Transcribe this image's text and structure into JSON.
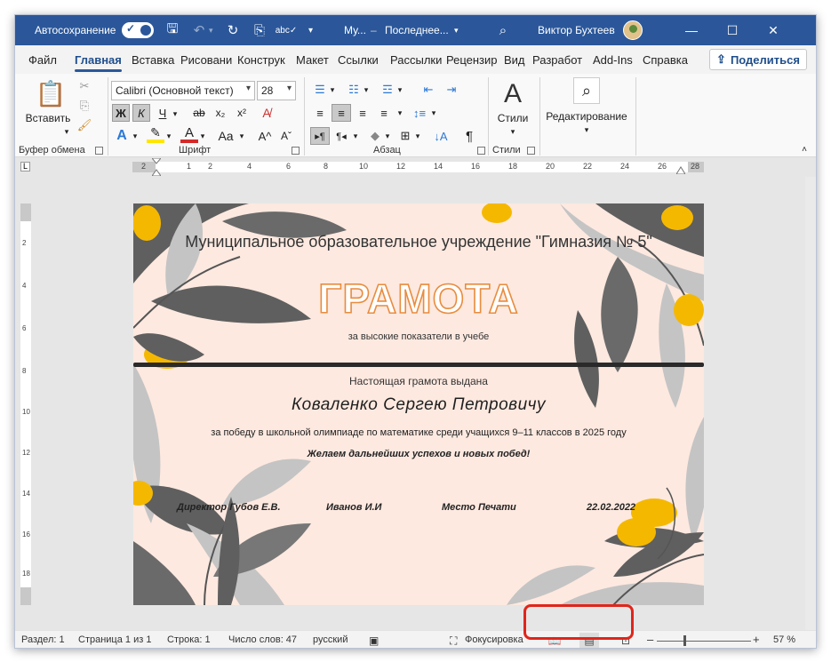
{
  "titlebar": {
    "autosave_label": "Автосохранение",
    "doc_title": "Му...",
    "save_location": "Последнее...",
    "user_name": "Виктор Бухтеев"
  },
  "tabs": [
    "Файл",
    "Главная",
    "Вставка",
    "Рисовани",
    "Конструк",
    "Макет",
    "Ссылки",
    "Рассылки",
    "Рецензир",
    "Вид",
    "Разработ",
    "Add-Ins",
    "Справка"
  ],
  "share_label": "Поделиться",
  "ribbon": {
    "clipboard": {
      "paste_label": "Вставить",
      "group_label": "Буфер обмена"
    },
    "font": {
      "font_name": "Calibri (Основной текст)",
      "font_size": "28",
      "bold": "Ж",
      "italic": "К",
      "underline": "Ч",
      "strikethrough": "ab",
      "subscript": "x₂",
      "superscript": "x²",
      "case_label": "Aa",
      "grow_label": "A^",
      "shrink_label": "Aˇ",
      "group_label": "Шрифт"
    },
    "paragraph": {
      "group_label": "Абзац"
    },
    "styles": {
      "label": "Стили",
      "group_label": "Стили"
    },
    "editing": {
      "label": "Редактирование"
    }
  },
  "ruler": [
    "2",
    "1",
    "2",
    "4",
    "6",
    "8",
    "10",
    "12",
    "14",
    "16",
    "18",
    "20",
    "22",
    "24",
    "26",
    "28"
  ],
  "vruler": [
    "2",
    "4",
    "6",
    "8",
    "10",
    "12",
    "14",
    "16",
    "18"
  ],
  "document": {
    "institution": "Муниципальное образовательное учреждение \"Гимназия № 5\"",
    "title": "ГРАМОТА",
    "subtitle": "за высокие показатели в учебе",
    "issued": "Настоящая грамота выдана",
    "recipient": "Коваленко Сергею Петровичу",
    "reason": "за победу в школьной олимпиаде по математике среди учащихся 9–11 классов в 2025 году",
    "wish": "Желаем дальнейших успехов и новых побед!",
    "signatures": [
      "Директор Губов Е.В.",
      "Иванов И.И",
      "Место Печати",
      "22.02.2022"
    ]
  },
  "status": {
    "section": "Раздел: 1",
    "page": "Страница 1 из 1",
    "line": "Строка: 1",
    "words": "Число слов: 47",
    "language": "русский",
    "focus": "Фокусировка",
    "zoom_minus": "–",
    "zoom_plus": "+",
    "zoom_percent": "57 %"
  },
  "colors": {
    "titlebar": "#2b579a",
    "page_background": "#fde9e0",
    "title_outline": "#e98c3e",
    "leaf_dark": "#5f5f5f",
    "leaf_light": "#c4c4c4",
    "accent_dot": "#f5b800",
    "highlight_box": "#e0251b"
  }
}
